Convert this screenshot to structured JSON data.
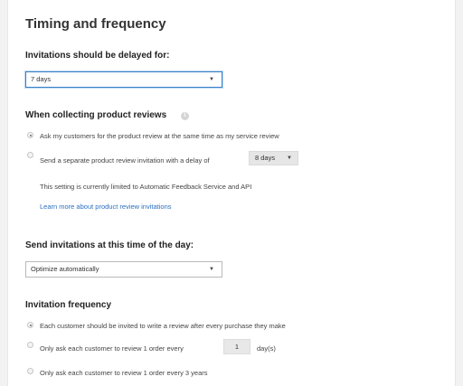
{
  "section": {
    "title": "Timing and frequency"
  },
  "delay": {
    "label": "Invitations should be delayed for:",
    "value": "7 days"
  },
  "product_reviews": {
    "heading": "When collecting product reviews",
    "info_icon": "info-icon",
    "option_same_time": "Ask my customers for the product review at the same time as my service review",
    "option_separate": "Send a separate product review invitation with a delay of",
    "separate_delay_value": "8 days",
    "note": "This setting is currently limited to Automatic Feedback Service and API",
    "learn_more": "Learn more about product review invitations"
  },
  "time_of_day": {
    "label": "Send invitations at this time of the day:",
    "value": "Optimize automatically"
  },
  "frequency": {
    "heading": "Invitation frequency",
    "option_every": "Each customer should be invited to write a review after every purchase they make",
    "option_days_prefix": "Only ask each customer to review 1 order every",
    "option_days_value": "1",
    "option_days_suffix": "day(s)",
    "option_years": "Only ask each customer to review 1 order every 3 years"
  },
  "colors": {
    "link": "#2b6fc0",
    "focus_border": "#3a80c8",
    "background": "#f2f2f2"
  }
}
